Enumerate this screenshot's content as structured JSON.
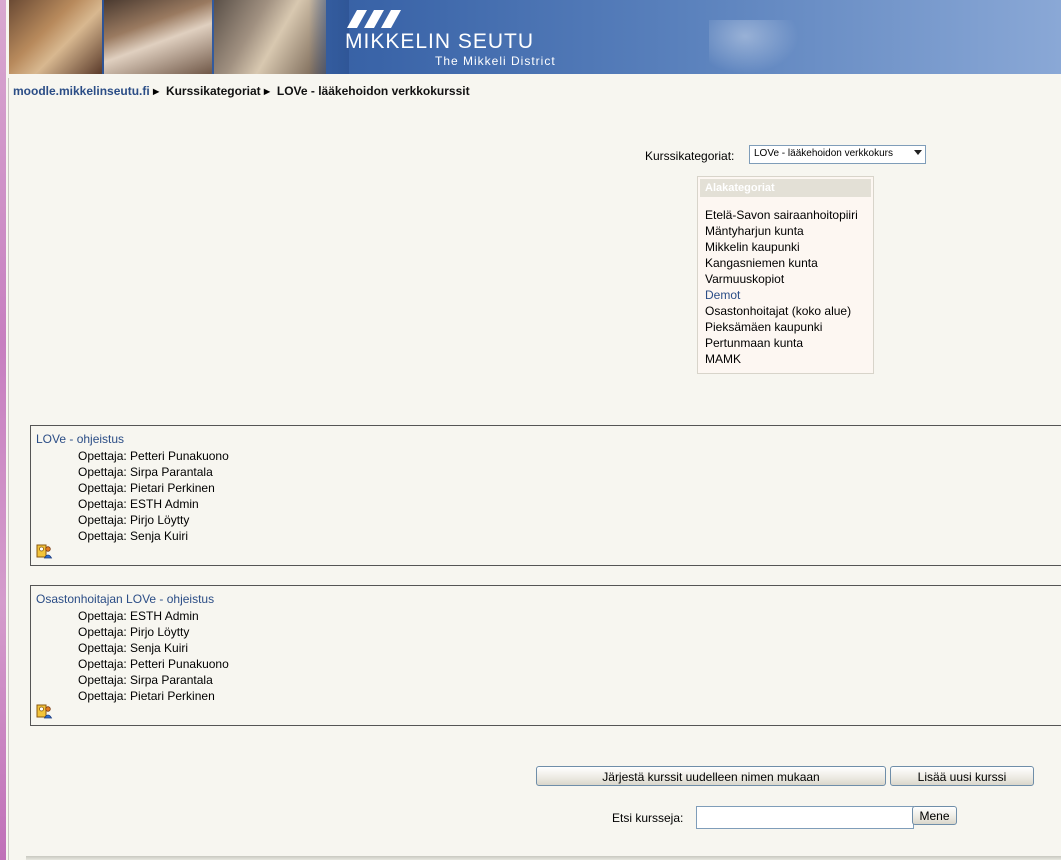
{
  "header": {
    "brand_title": "MIKKELIN SEUTU",
    "brand_subtitle": "The Mikkeli District"
  },
  "breadcrumb": {
    "home": "moodle.mikkelinseutu.fi",
    "separator": "►",
    "items": [
      "Kurssikategoriat",
      "LOVe - lääkehoidon verkkokurssit"
    ]
  },
  "category_selector": {
    "label": "Kurssikategoriat:",
    "selected": "LOVe - lääkehoidon verkkokurs"
  },
  "subcategories": {
    "title": "Alakategoriat",
    "items": [
      "Etelä-Savon sairaanhoitopiiri",
      "Mäntyharjun kunta",
      "Mikkelin kaupunki",
      "Kangasniemen kunta",
      "Varmuuskopiot",
      "Demot",
      "Osastonhoitajat (koko alue)",
      "Pieksämäen kaupunki",
      "Pertunmaan kunta",
      "MAMK"
    ]
  },
  "courses": [
    {
      "title": "LOVe - ohjeistus",
      "teachers": [
        "Opettaja: Petteri Punakuono",
        "Opettaja: Sirpa Parantala",
        "Opettaja: Pietari Perkinen",
        "Opettaja: ESTH Admin",
        "Opettaja: Pirjo Löytty",
        "Opettaja: Senja Kuiri"
      ],
      "icon": "guest-access-icon"
    },
    {
      "title": "Osastonhoitajan LOVe - ohjeistus",
      "teachers": [
        "Opettaja: ESTH Admin",
        "Opettaja: Pirjo Löytty",
        "Opettaja: Senja Kuiri",
        "Opettaja: Petteri Punakuono",
        "Opettaja: Sirpa Parantala",
        "Opettaja: Pietari Perkinen"
      ],
      "icon": "guest-access-icon"
    }
  ],
  "actions": {
    "sort_label": "Järjestä kurssit uudelleen nimen mukaan",
    "add_label": "Lisää uusi kurssi"
  },
  "search": {
    "label": "Etsi kursseja:",
    "value": "",
    "button_label": "Mene"
  },
  "colors": {
    "link": "#2b4d86",
    "header_blue": "#2a4f8f",
    "background": "#f7f6f0"
  }
}
